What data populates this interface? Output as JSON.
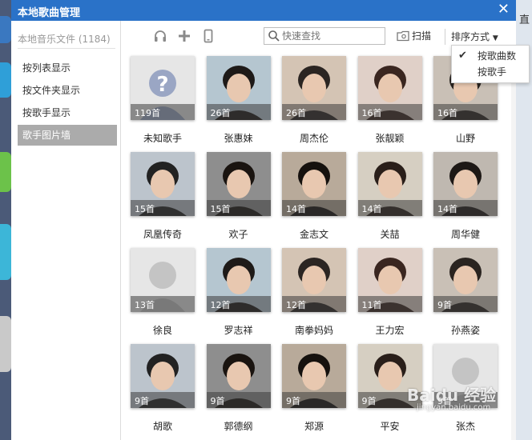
{
  "background_app": {
    "right_edge_text": "直"
  },
  "dialog": {
    "title": "本地歌曲管理",
    "close_glyph": "✕"
  },
  "sidebar": {
    "header": "本地音乐文件 (1184)",
    "items": [
      {
        "label": "按列表显示",
        "active": false
      },
      {
        "label": "按文件夹显示",
        "active": false
      },
      {
        "label": "按歌手显示",
        "active": false
      },
      {
        "label": "歌手图片墙",
        "active": true
      }
    ]
  },
  "toolbar": {
    "icons": [
      "headphone-icon",
      "plus-icon",
      "phone-icon"
    ],
    "search_placeholder": "快速查找",
    "scan_label": "扫描",
    "sort_label": "排序方式"
  },
  "sort_menu": {
    "items": [
      {
        "label": "按歌曲数",
        "checked": true
      },
      {
        "label": "按歌手",
        "checked": false
      }
    ]
  },
  "artists": [
    {
      "name": "未知歌手",
      "count": "119首",
      "placeholder": true
    },
    {
      "name": "张惠妹",
      "count": "26首"
    },
    {
      "name": "周杰伦",
      "count": "26首"
    },
    {
      "name": "张靓颖",
      "count": "16首"
    },
    {
      "name": "山野",
      "count": "16首"
    },
    {
      "name": "凤凰传奇",
      "count": "15首"
    },
    {
      "name": "欢子",
      "count": "15首"
    },
    {
      "name": "金志文",
      "count": "14首"
    },
    {
      "name": "关喆",
      "count": "14首"
    },
    {
      "name": "周华健",
      "count": "14首"
    },
    {
      "name": "徐良",
      "count": "13首",
      "placeholder": true
    },
    {
      "name": "罗志祥",
      "count": "12首"
    },
    {
      "name": "南拳妈妈",
      "count": "12首"
    },
    {
      "name": "王力宏",
      "count": "11首"
    },
    {
      "name": "孙燕姿",
      "count": "9首"
    },
    {
      "name": "胡歌",
      "count": "9首"
    },
    {
      "name": "郭德纲",
      "count": "9首"
    },
    {
      "name": "郑源",
      "count": "9首"
    },
    {
      "name": "平安",
      "count": "9首"
    },
    {
      "name": "张杰",
      "count": "9首",
      "placeholder": true
    }
  ],
  "watermark": {
    "text": "Baidu 经验",
    "sub": "jingyan.baidu.com"
  },
  "colors": {
    "titlebar": "#2a72c8",
    "sidebar_active": "#ababab"
  }
}
